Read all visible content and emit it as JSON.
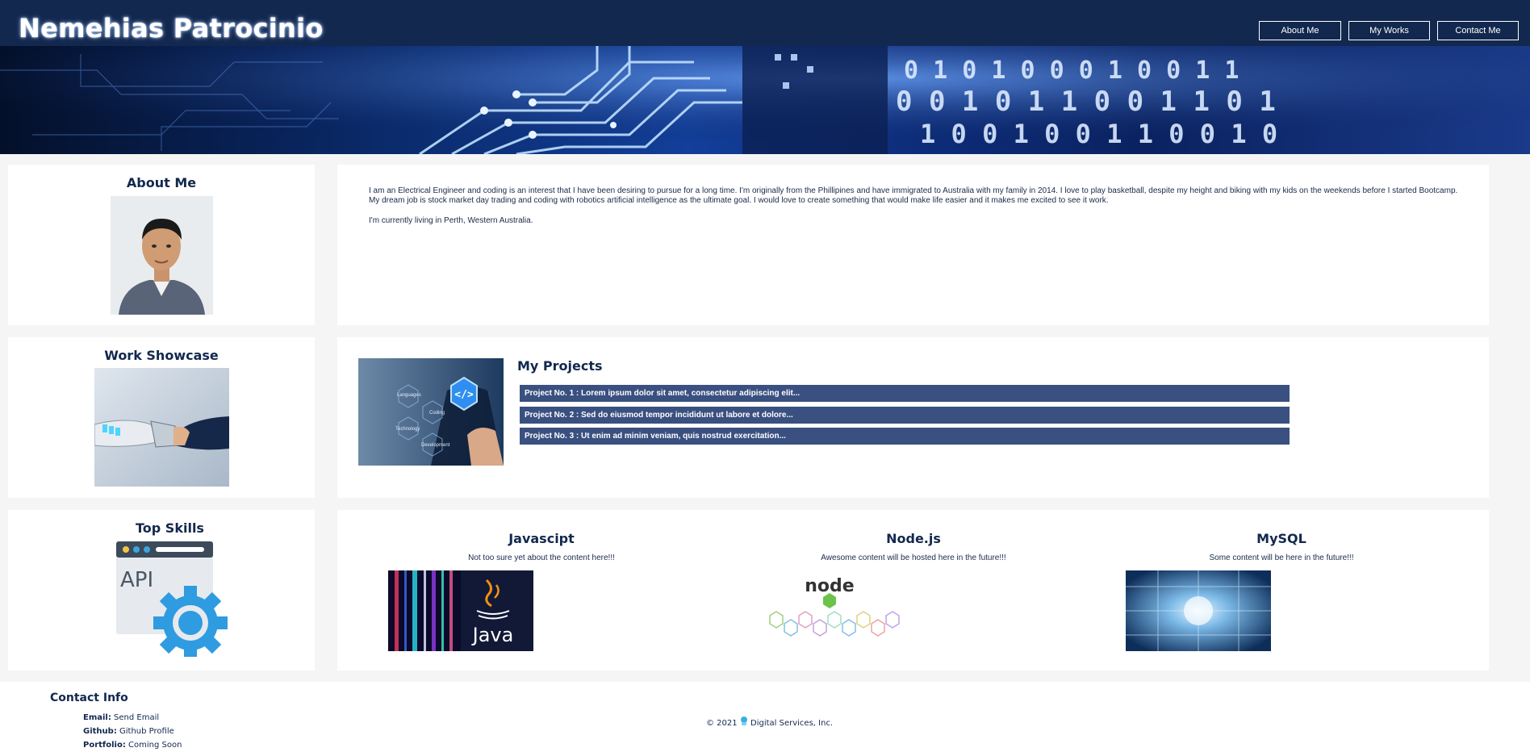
{
  "header": {
    "site_title": "Nemehias Patrocinio",
    "nav": [
      {
        "label": "About Me"
      },
      {
        "label": "My Works"
      },
      {
        "label": "Contact Me"
      }
    ]
  },
  "about": {
    "heading": "About Me",
    "paragraph_1": "I am an Electrical Engineer and coding is an interest that I have been desiring to pursue for a long time. I'm originally from the Phillipines and have immigrated to Australia with my family in 2014. I love to play basketball, despite my height and biking with my kids on the weekends before I started Bootcamp. My dream job is stock market day trading and coding with robotics artificial intelligence as the ultimate goal. I would love to create something that would make life easier and it makes me excited to see it work.",
    "paragraph_2": "I'm currently living in Perth, Western Australia."
  },
  "work": {
    "heading": "Work Showcase",
    "projects_heading": "My Projects",
    "projects": [
      {
        "label": "Project No. 1 : Lorem ipsum dolor sit amet, consectetur adipiscing elit..."
      },
      {
        "label": "Project No. 2 : Sed do eiusmod tempor incididunt ut labore et dolore..."
      },
      {
        "label": "Project No. 3 : Ut enim ad minim veniam, quis nostrud exercitation..."
      }
    ],
    "tech_image_labels": [
      "Languages",
      "Coding",
      "Technology",
      "Development"
    ]
  },
  "skills": {
    "heading": "Top Skills",
    "api_icon_text": "API",
    "items": [
      {
        "title": "Javascipt",
        "description": "Not too sure yet about the content here!!!",
        "image_text": "Java"
      },
      {
        "title": "Node.js",
        "description": "Awesome content will be hosted here in the future!!!",
        "image_text": "node"
      },
      {
        "title": "MySQL",
        "description": "Some content will be here in the future!!!"
      }
    ]
  },
  "footer": {
    "contact_title": "Contact Info",
    "email_label": "Email:",
    "email_value": "Send Email",
    "github_label": "Github:",
    "github_value": "Github Profile",
    "portfolio_label": "Portfolio:",
    "portfolio_value": "Coming Soon",
    "copyright_prefix": "© 2021",
    "copyright_suffix": "Digital Services, Inc."
  },
  "colors": {
    "header_bg": "#13284e",
    "project_bar": "#3a5080",
    "heading_text": "#13284e",
    "page_bg": "#f5f5f5"
  },
  "icons": [
    "robot-handshake-image",
    "api-gear-icon",
    "java-logo",
    "nodejs-logo",
    "circuit-banner",
    "profile-photo",
    "cyber-icon"
  ]
}
